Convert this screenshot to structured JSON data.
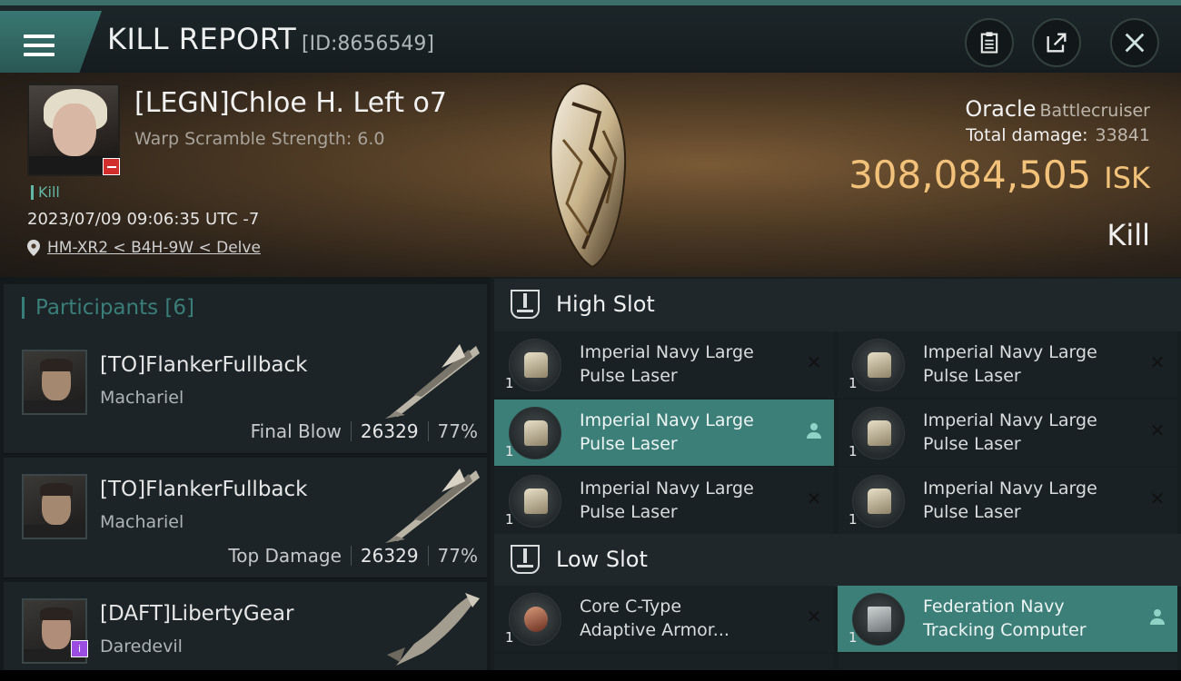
{
  "header": {
    "title": "KILL REPORT",
    "id_label": "[ID:8656549]",
    "icons": [
      "menu-icon",
      "clipboard-icon",
      "share-icon",
      "close-icon"
    ]
  },
  "victim": {
    "name": "[LEGN]Chloe H. Left o7",
    "warp_scramble": "Warp Scramble Strength: 6.0",
    "tag": "Kill",
    "datetime": "2023/07/09 09:06:35 UTC -7",
    "location": "HM-XR2 < B4H-9W < Delve",
    "ship_name": "Oracle",
    "ship_class": "Battlecruiser",
    "total_damage_label": "Total damage:",
    "total_damage_value": "33841",
    "isk_value": "308,084,505",
    "isk_unit": "ISK",
    "result": "Kill"
  },
  "participants": {
    "title": "Participants [6]",
    "rows": [
      {
        "name": "[TO]FlankerFullback",
        "ship": "Machariel",
        "role": "Final Blow",
        "damage": "26329",
        "percent": "77%"
      },
      {
        "name": "[TO]FlankerFullback",
        "ship": "Machariel",
        "role": "Top Damage",
        "damage": "26329",
        "percent": "77%"
      },
      {
        "name": "[DAFT]LibertyGear",
        "ship": "Daredevil"
      }
    ]
  },
  "fitting": {
    "high_slot_label": "High Slot",
    "low_slot_label": "Low Slot",
    "high_items": [
      {
        "line1": "Imperial Navy Large",
        "line2": "Pulse Laser",
        "qty": "1",
        "status": "destroyed"
      },
      {
        "line1": "Imperial Navy Large",
        "line2": "Pulse Laser",
        "qty": "1",
        "status": "destroyed"
      },
      {
        "line1": "Imperial Navy Large",
        "line2": "Pulse Laser",
        "qty": "1",
        "status": "dropped"
      },
      {
        "line1": "Imperial Navy Large",
        "line2": "Pulse Laser",
        "qty": "1",
        "status": "destroyed"
      },
      {
        "line1": "Imperial Navy Large",
        "line2": "Pulse Laser",
        "qty": "1",
        "status": "destroyed"
      },
      {
        "line1": "Imperial Navy Large",
        "line2": "Pulse Laser",
        "qty": "1",
        "status": "destroyed"
      }
    ],
    "low_items": [
      {
        "line1": "Core C-Type",
        "line2": "Adaptive Armor...",
        "qty": "1",
        "status": "destroyed"
      },
      {
        "line1": "Federation Navy",
        "line2": "Tracking Computer",
        "qty": "1",
        "status": "dropped"
      }
    ]
  },
  "colors": {
    "accent": "#3b7f78",
    "isk": "#f3c27a",
    "destroyed_badge": "#d22e2e"
  }
}
